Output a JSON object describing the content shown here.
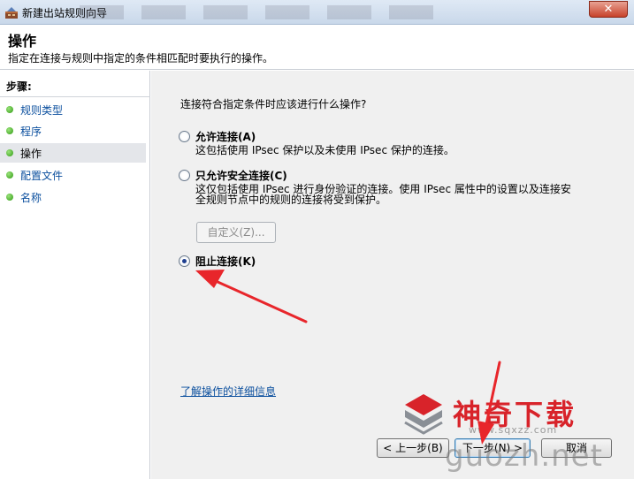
{
  "window": {
    "title": "新建出站规则向导",
    "close_glyph": "✕"
  },
  "header": {
    "title": "操作",
    "description": "指定在连接与规则中指定的条件相匹配时要执行的操作。"
  },
  "steps": {
    "label": "步骤:",
    "items": [
      {
        "label": "规则类型",
        "active": false
      },
      {
        "label": "程序",
        "active": false
      },
      {
        "label": "操作",
        "active": true
      },
      {
        "label": "配置文件",
        "active": false
      },
      {
        "label": "名称",
        "active": false
      }
    ]
  },
  "main": {
    "question": "连接符合指定条件时应该进行什么操作?",
    "options": [
      {
        "label": "允许连接(A)",
        "description": "这包括使用 IPsec 保护以及未使用 IPsec 保护的连接。",
        "checked": false
      },
      {
        "label": "只允许安全连接(C)",
        "description_line1": "这仅包括使用 IPsec 进行身份验证的连接。使用 IPsec 属性中的设置以及连接安",
        "description_line2": "全规则节点中的规则的连接将受到保护。",
        "checked": false
      },
      {
        "label": "阻止连接(K)",
        "checked": true
      }
    ],
    "custom_button": "自定义(Z)...",
    "learn_link": "了解操作的详细信息"
  },
  "buttons": {
    "back": "< 上一步(B)",
    "next": "下一步(N) >",
    "cancel": "取消"
  },
  "watermark": {
    "brand": "神奇下载",
    "url": "www.sqxzz.com",
    "site": "guozh.net"
  },
  "colors": {
    "link": "#0b4f9e",
    "annotation_arrow": "#e8262b",
    "watermark_red": "#d8232a"
  }
}
